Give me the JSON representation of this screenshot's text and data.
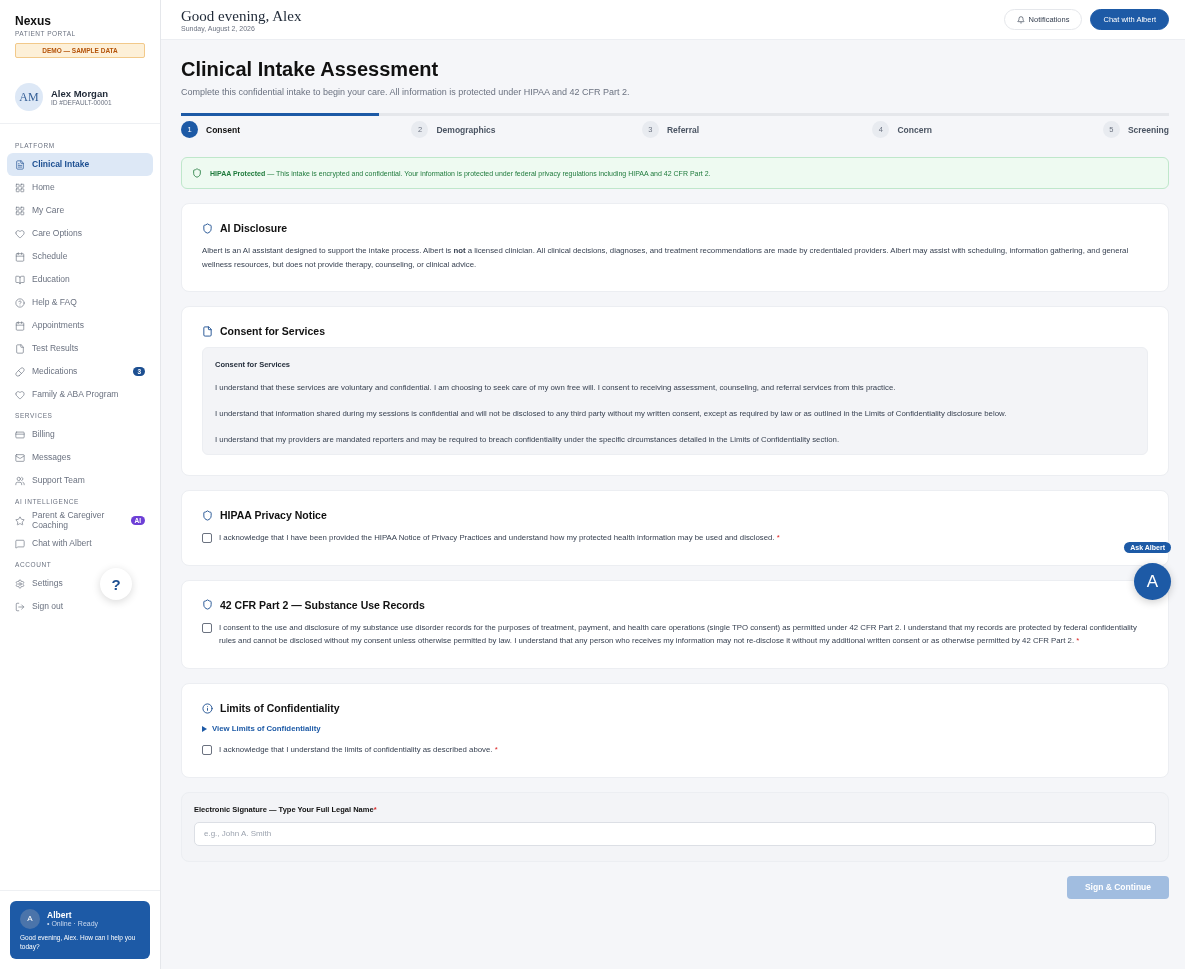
{
  "brand": {
    "name": "Nexus",
    "subtitle": "PATIENT PORTAL",
    "demo_badge": "DEMO — SAMPLE DATA"
  },
  "user": {
    "initials": "AM",
    "name": "Alex Morgan",
    "id": "ID #DEFAULT-00001"
  },
  "sidebar": {
    "sections": [
      {
        "title": "PLATFORM",
        "items": [
          {
            "label": "Clinical Intake",
            "selected": true
          },
          {
            "label": "Home",
            "selected": false
          },
          {
            "label": "My Care",
            "selected": false
          },
          {
            "label": "Care Options",
            "selected": false
          },
          {
            "label": "Schedule",
            "selected": false
          },
          {
            "label": "Education",
            "selected": false
          },
          {
            "label": "Help & FAQ",
            "selected": false
          },
          {
            "label": "Appointments",
            "selected": false
          },
          {
            "label": "Test Results",
            "selected": false
          },
          {
            "label": "Medications",
            "selected": false,
            "badge": "3",
            "color": "#1d4f91"
          },
          {
            "label": "Family & ABA Program",
            "selected": false
          }
        ]
      },
      {
        "title": "SERVICES",
        "items": [
          {
            "label": "Billing",
            "selected": false
          },
          {
            "label": "Messages",
            "selected": false
          },
          {
            "label": "Support Team",
            "selected": false
          }
        ]
      },
      {
        "title": "AI INTELLIGENCE",
        "items": [
          {
            "label": "Parent & Caregiver Coaching",
            "selected": false,
            "badge": "AI",
            "color": "#6d3fd6"
          },
          {
            "label": "Chat with Albert",
            "selected": false
          }
        ]
      },
      {
        "title": "ACCOUNT",
        "items": [
          {
            "label": "Settings",
            "selected": false
          },
          {
            "label": "Sign out",
            "selected": false
          }
        ]
      }
    ]
  },
  "help_button": "?",
  "assistant_card": {
    "initial": "A",
    "name": "Albert",
    "status": "• Online · Ready",
    "message": "Good evening, Alex. How can I help you today?"
  },
  "header": {
    "greeting": "Good evening, Alex",
    "date": "Sunday, August 2, 2026",
    "buttons": [
      {
        "label": "Notifications",
        "kind": "secondary"
      },
      {
        "label": "Chat with Albert",
        "kind": "primary"
      }
    ]
  },
  "page": {
    "title": "Clinical Intake Assessment",
    "subtitle": "Complete this confidential intake to begin your care. All information is protected under HIPAA and 42 CFR Part 2."
  },
  "stepper": {
    "level": 0.2,
    "steps": [
      {
        "number": "1",
        "label": "Consent",
        "selected": true
      },
      {
        "number": "2",
        "label": "Demographics",
        "selected": false
      },
      {
        "number": "3",
        "label": "Referral",
        "selected": false
      },
      {
        "number": "4",
        "label": "Concern",
        "selected": false
      },
      {
        "number": "5",
        "label": "Screening",
        "selected": false
      }
    ]
  },
  "notice": {
    "title": "HIPAA Protected",
    "text": "— This intake is encrypted and confidential. Your information is protected under federal privacy regulations including HIPAA and 42 CFR Part 2."
  },
  "sections": [
    {
      "kind": "text",
      "title": "AI Disclosure",
      "text": "Albert is an AI assistant designed to support the intake process. Albert is **not** a licensed clinician. All clinical decisions, diagnoses, and treatment recommendations are made by credentialed providers. Albert may assist with scheduling, information gathering, and general wellness resources, but does not provide therapy, counseling, or clinical advice."
    },
    {
      "kind": "document",
      "title": "Consent for Services",
      "doc_title": "Consent for Services",
      "paragraphs": [
        "I understand that these services are voluntary and confidential. I am choosing to seek care of my own free will. I consent to receiving assessment, counseling, and referral services from this practice.",
        "I understand that information shared during my sessions is confidential and will not be disclosed to any third party without my written consent, except as required by law or as outlined in the Limits of Confidentiality disclosure below.",
        "I understand that my providers are mandated reporters and may be required to breach confidentiality under the specific circumstances detailed in the Limits of Confidentiality section."
      ]
    },
    {
      "kind": "checkbox",
      "title": "HIPAA Privacy Notice",
      "checkbox": {
        "label": "I acknowledge that I have been provided the HIPAA Notice of Privacy Practices and understand how my protected health information may be used and disclosed.",
        "required_mark": "*",
        "checked": false
      }
    },
    {
      "kind": "checkbox",
      "title": "42 CFR Part 2 — Substance Use Records",
      "checkbox": {
        "label": "I consent to the use and disclosure of my substance use disorder records for the purposes of treatment, payment, and health care operations (single TPO consent) as permitted under 42 CFR Part 2. I understand that my records are protected by federal confidentiality rules and cannot be disclosed without my consent unless otherwise permitted by law. I understand that any person who receives my information may not re-disclose it without my additional written consent or as otherwise permitted by 42 CFR Part 2.",
        "required_mark": "*",
        "checked": false
      }
    },
    {
      "kind": "checkbox",
      "title": "Limits of Confidentiality",
      "toggle": {
        "label": "View Limits of Confidentiality",
        "expanded": false
      },
      "checkbox": {
        "label": "I acknowledge that I understand the limits of confidentiality as described above.",
        "required_mark": "*",
        "checked": false
      }
    }
  ],
  "signature": {
    "label": "Electronic Signature — Type Your Full Legal Name",
    "required_mark": "*",
    "placeholder": "e.g., John A. Smith"
  },
  "submit": {
    "label": "Sign & Continue",
    "disabled": true
  },
  "ask_albert": {
    "label": "Ask Albert",
    "initial": "A"
  }
}
